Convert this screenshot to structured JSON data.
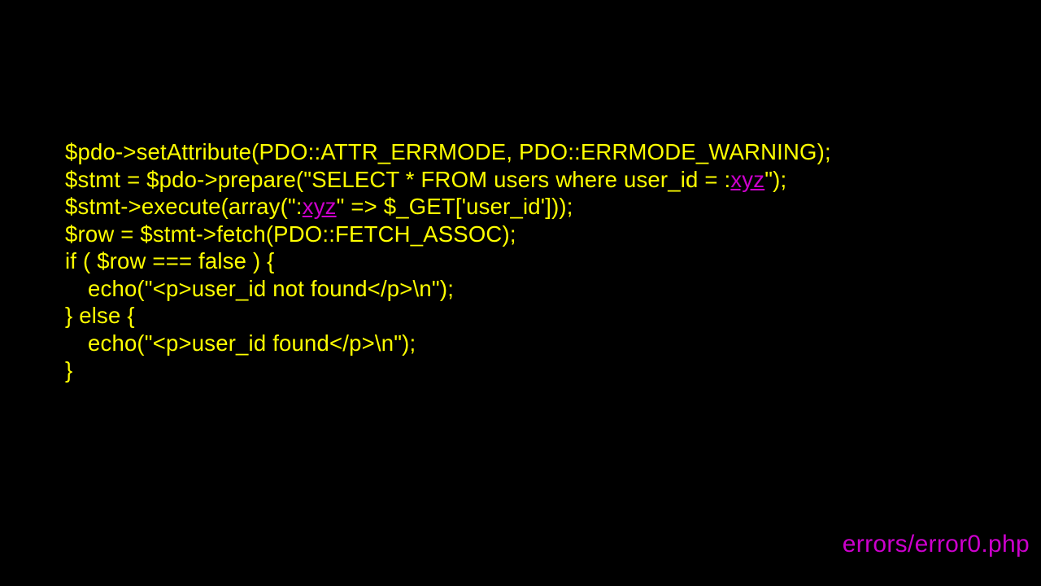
{
  "code": {
    "l1a": "$pdo->setAttribute(PDO::ATTR_ERRMODE, PDO::ERRMODE_WARNING);",
    "blank": "",
    "l2a": "$stmt = $pdo->prepare(\"SELECT * FROM users where user_id = :",
    "l2ph": "xyz",
    "l2b": "\");",
    "l3a": "$stmt->execute(array(\":",
    "l3ph": "xyz",
    "l3b": "\" => $_GET['user_id']));",
    "l4": "$row = $stmt->fetch(PDO::FETCH_ASSOC);",
    "l5": "if ( $row === false ) {",
    "l6": "echo(\"<p>user_id not found</p>\\n\");",
    "l7": "} else {",
    "l8": "echo(\"<p>user_id found</p>\\n\");",
    "l9": "}"
  },
  "footer": "errors/error0.php"
}
